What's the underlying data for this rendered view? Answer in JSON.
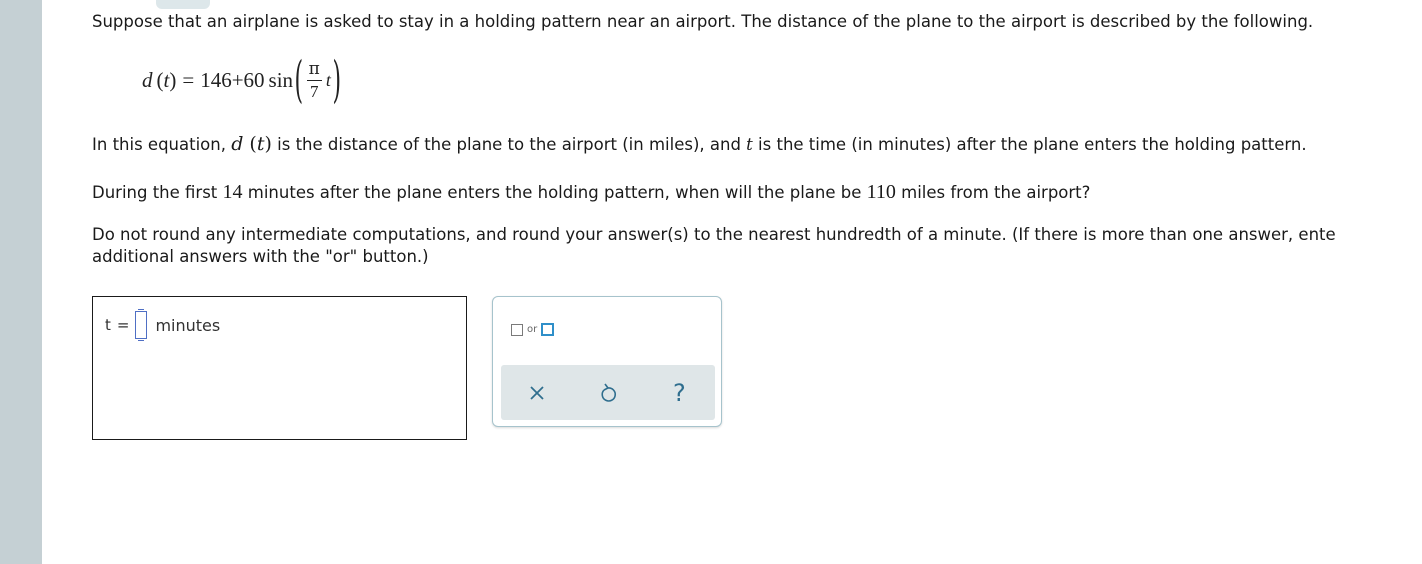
{
  "problem": {
    "intro": "Suppose that an airplane is asked to stay in a holding pattern near an airport. The distance of the plane to the airport is described by the following.",
    "equation": {
      "lhs_func": "d",
      "lhs_var": "t",
      "equals": "=",
      "constant": "146",
      "plus": "+",
      "amplitude": "60",
      "func": "sin",
      "frac_num": "π",
      "frac_den": "7",
      "arg_var": "t"
    },
    "explanation": {
      "part1": "In this equation, ",
      "func": "d",
      "var": "t",
      "part2": " is the distance of the plane to the airport (in miles), and ",
      "var2": "t",
      "part3": " is the time (in minutes) after the plane enters the holding pattern."
    },
    "question": {
      "part1": "During the first ",
      "minutes": "14",
      "part2": " minutes after the plane enters the holding pattern, when will the plane be ",
      "miles": "110",
      "part3": " miles from the airport?"
    },
    "instructions_line1": "Do not round any intermediate computations, and round your answer(s) to the nearest hundredth of a minute. (If there is more than one answer, ente",
    "instructions_line2": "additional answers with the \"or\" button.)"
  },
  "answer": {
    "variable": "t",
    "equals": "=",
    "value": "",
    "unit": "minutes"
  },
  "palette": {
    "or_label": "or",
    "help_label": "?",
    "accent_color": "#2f8fc9",
    "icons": [
      "close-icon",
      "undo-icon",
      "help-icon"
    ]
  }
}
